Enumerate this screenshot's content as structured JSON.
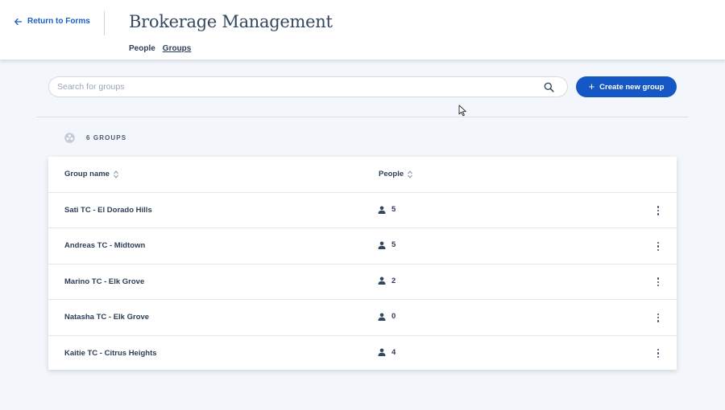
{
  "header": {
    "back_label": "Return to Forms",
    "title": "Brokerage Management",
    "tabs": [
      {
        "label": "People",
        "active": false
      },
      {
        "label": "Groups",
        "active": true
      }
    ]
  },
  "search": {
    "placeholder": "Search for groups",
    "value": ""
  },
  "actions": {
    "create_label": "Create new group"
  },
  "summary": {
    "count_label": "6 GROUPS"
  },
  "table": {
    "columns": [
      {
        "label": "Group name",
        "sortable": true
      },
      {
        "label": "People",
        "sortable": true
      }
    ],
    "rows": [
      {
        "name": "Sati TC - El Dorado Hills",
        "people": "5"
      },
      {
        "name": "Andreas TC - Midtown",
        "people": "5"
      },
      {
        "name": "Marino TC - Elk Grove",
        "people": "2"
      },
      {
        "name": "Natasha TC - Elk Grove",
        "people": "0"
      },
      {
        "name": "Kaitie TC - Citrus Heights",
        "people": "4"
      }
    ]
  },
  "icons": {
    "back": "arrow-left-icon",
    "search": "search-icon",
    "create": "plus-icon",
    "groups": "group-icon",
    "sort": "sort-icon",
    "person": "person-icon",
    "row_menu": "more-vertical-icon"
  },
  "colors": {
    "accent": "#1557c4",
    "link": "#1a5dc7",
    "text": "#2c3e55",
    "background": "#f3f6fa"
  }
}
